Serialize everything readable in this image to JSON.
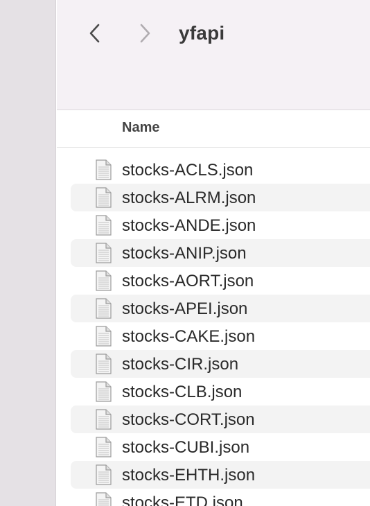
{
  "toolbar": {
    "back_icon": "chevron-left-icon",
    "forward_icon": "chevron-right-icon",
    "folder_title": "yfapi"
  },
  "columns": {
    "name": "Name"
  },
  "files": [
    "stocks-ACLS.json",
    "stocks-ALRM.json",
    "stocks-ANDE.json",
    "stocks-ANIP.json",
    "stocks-AORT.json",
    "stocks-APEI.json",
    "stocks-CAKE.json",
    "stocks-CIR.json",
    "stocks-CLB.json",
    "stocks-CORT.json",
    "stocks-CUBI.json",
    "stocks-EHTH.json",
    "stocks-ETD.json"
  ],
  "colors": {
    "sidebar": "#e5e1e5",
    "toolbar": "#f5f1f5",
    "alt_row": "#f3f3f3"
  }
}
